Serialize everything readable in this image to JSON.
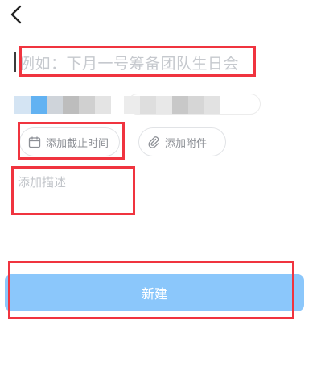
{
  "nav": {
    "back_icon": "chevron-left-icon"
  },
  "title": {
    "placeholder": "例如：下月一号筹备团队生日会"
  },
  "participants": {
    "blurred": true
  },
  "chips": {
    "deadline": {
      "icon": "calendar-icon",
      "label": "添加截止时间"
    },
    "attachment": {
      "icon": "paperclip-icon",
      "label": "添加附件"
    }
  },
  "description": {
    "placeholder": "添加描述"
  },
  "create_button": {
    "label": "新建"
  },
  "colors": {
    "accent": "#8bc7fb",
    "annotation": "#f0343f",
    "placeholder": "#c6c9ce"
  }
}
